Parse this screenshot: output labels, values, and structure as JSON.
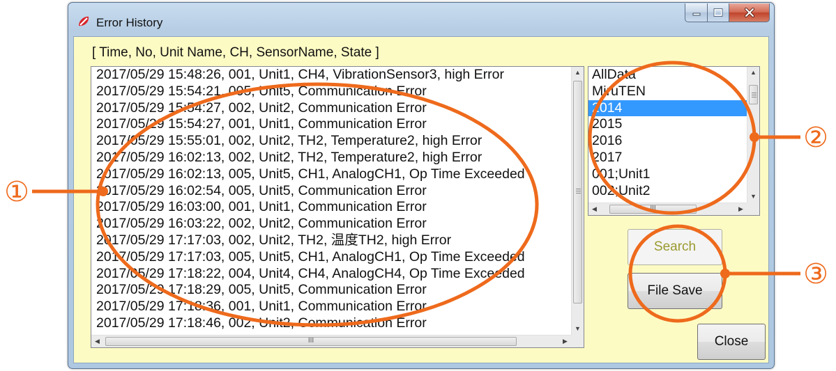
{
  "window": {
    "title": "Error History",
    "caption_buttons": [
      "minimize-button",
      "maximize-button",
      "close-window-button"
    ]
  },
  "header_label": "[ Time, No, Unit Name, CH, SensorName, State ]",
  "error_list": {
    "rows": [
      "2017/05/29 15:48:26, 001, Unit1, CH4, VibrationSensor3, high Error",
      "2017/05/29 15:54:21, 005, Unit5, Communication Error",
      "2017/05/29 15:54:27, 002, Unit2, Communication Error",
      "2017/05/29 15:54:27, 001, Unit1, Communication Error",
      "2017/05/29 15:55:01, 002, Unit2, TH2, Temperature2, high Error",
      "2017/05/29 16:02:13, 002, Unit2, TH2, Temperature2, high Error",
      "2017/05/29 16:02:13, 005, Unit5, CH1, AnalogCH1, Op Time Exceeded",
      "2017/05/29 16:02:54, 005, Unit5, Communication Error",
      "2017/05/29 16:03:00, 001, Unit1, Communication Error",
      "2017/05/29 16:03:22, 002, Unit2, Communication Error",
      "2017/05/29 17:17:03, 002, Unit2, TH2, 温度TH2, high Error",
      "2017/05/29 17:17:03, 005, Unit5, CH1, AnalogCH1, Op Time Exceeded",
      "2017/05/29 17:18:22, 004, Unit4, CH4, AnalogCH4, Op Time Exceeded",
      "2017/05/29 17:18:29, 005, Unit5, Communication Error",
      "2017/05/29 17:18:36, 001, Unit1, Communication Error",
      "2017/05/29 17:18:46, 002, Unit2, Communication Error"
    ],
    "hscroll_grip": "III"
  },
  "filter_list": {
    "items": [
      "AllData",
      "MiruTEN",
      "2014",
      "2015",
      "2016",
      "2017",
      "001;Unit1",
      "002;Unit2"
    ],
    "selected": "2014",
    "hscroll_grip": "III"
  },
  "buttons": {
    "search": "Search",
    "file_save": "File Save",
    "close": "Close"
  },
  "callouts": [
    "①",
    "②",
    "③"
  ],
  "colors": {
    "client_bg": "#fdfbc4",
    "annotation": "#ee6a1c",
    "selection": "#3399ff",
    "title_icon": "#d8252c"
  }
}
